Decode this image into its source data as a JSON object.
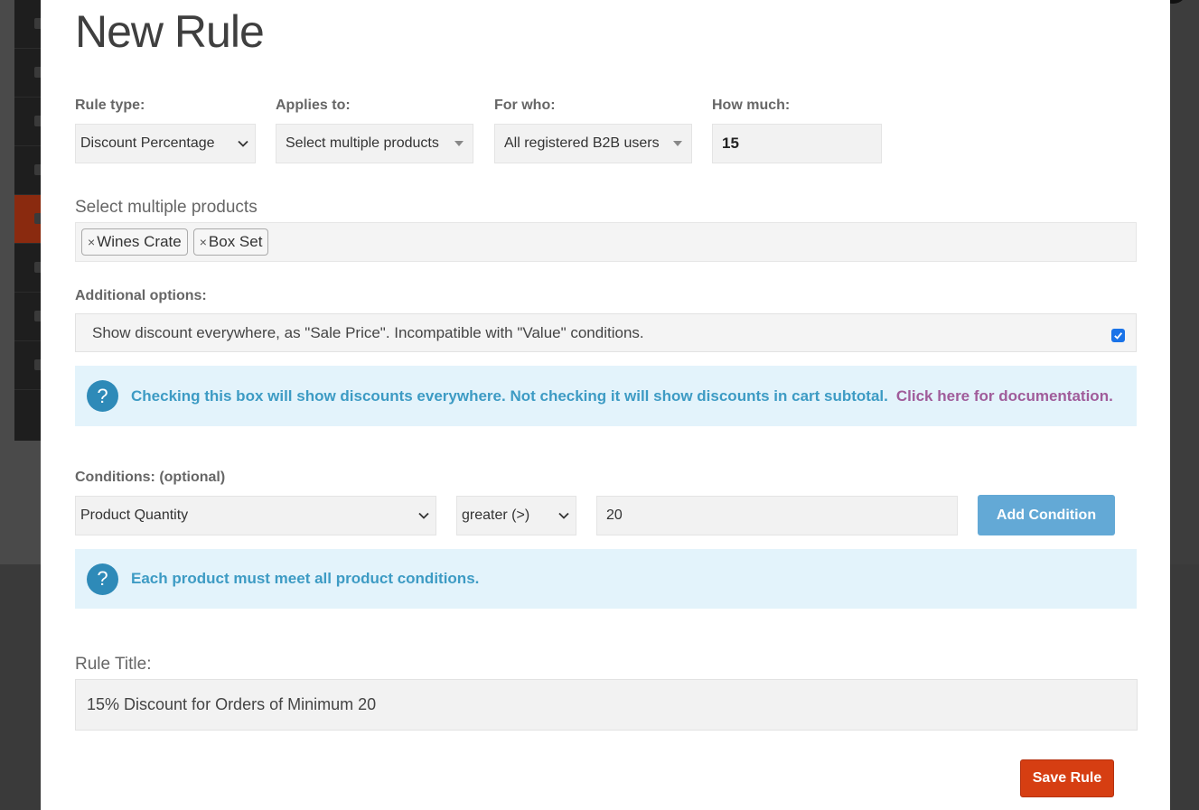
{
  "modal": {
    "title": "New Rule"
  },
  "rule_type": {
    "label": "Rule type:",
    "value": "Discount Percentage"
  },
  "applies_to": {
    "label": "Applies to:",
    "value": "Select multiple products"
  },
  "for_who": {
    "label": "For who:",
    "value": "All registered B2B users"
  },
  "how_much": {
    "label": "How much:",
    "value": "15"
  },
  "products": {
    "label": "Select multiple products",
    "tags": [
      "Wines Crate",
      "Box Set"
    ],
    "remove_glyph": "×"
  },
  "additional_options": {
    "label": "Additional options:",
    "sale_price_text": "Show discount everywhere, as \"Sale Price\". Incompatible with \"Value\" conditions.",
    "sale_price_checked": true
  },
  "info_discount": {
    "icon": "question-icon",
    "glyph": "?",
    "text": "Checking this box will show discounts everywhere. Not checking it will show discounts in cart subtotal.",
    "link": "Click here for documentation."
  },
  "conditions": {
    "label": "Conditions: (optional)",
    "type_value": "Product Quantity",
    "operator_value": "greater (>)",
    "amount_value": "20",
    "add_button": "Add Condition"
  },
  "info_conditions": {
    "icon": "question-icon",
    "glyph": "?",
    "text": "Each product must meet all product conditions."
  },
  "rule_title": {
    "label": "Rule Title:",
    "value": "15% Discount for Orders of Minimum 20"
  },
  "save_button": "Save Rule",
  "colors": {
    "primary_button": "#63a9d6",
    "save_button": "#d63e12",
    "info_bg": "#e3f3fb",
    "info_text": "#3d9bc4",
    "link": "#a05c9a"
  }
}
